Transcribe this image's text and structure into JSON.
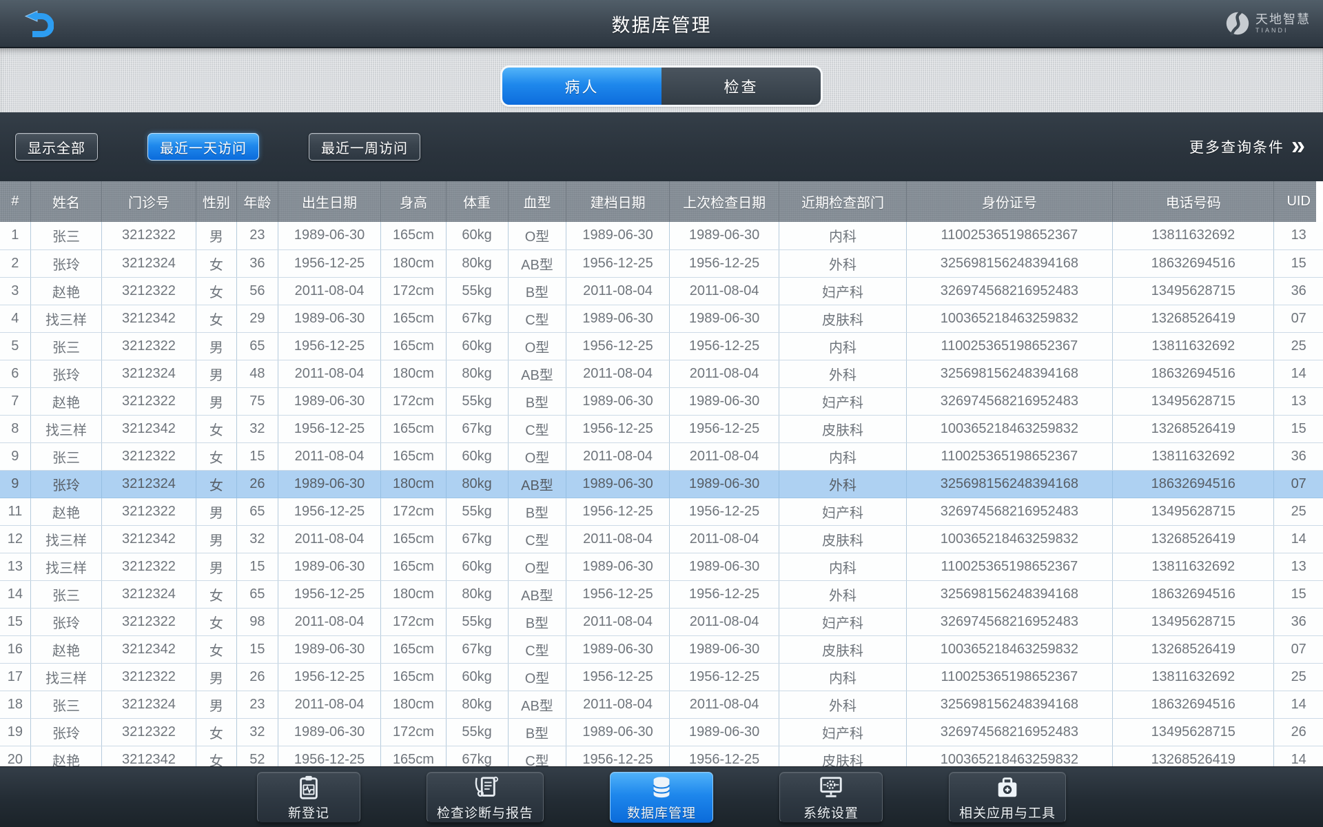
{
  "header": {
    "title": "数据库管理",
    "logo_text": "天地智慧",
    "logo_subtext": "TIANDI"
  },
  "tabs": [
    {
      "label": "病人",
      "active": true
    },
    {
      "label": "检查",
      "active": false
    }
  ],
  "filter_bar": {
    "show_all": "显示全部",
    "last_day": "最近一天访问",
    "last_week": "最近一周访问",
    "more_filters": "更多查询条件",
    "chevron": "»",
    "active_filter": "最近一天访问"
  },
  "table": {
    "columns": [
      "#",
      "姓名",
      "门诊号",
      "性别",
      "年龄",
      "出生日期",
      "身高",
      "体重",
      "血型",
      "建档日期",
      "上次检查日期",
      "近期检查部门",
      "身份证号",
      "电话号码",
      "UID"
    ],
    "highlighted_row_index": 9,
    "rows": [
      [
        "1",
        "张三",
        "3212322",
        "男",
        "23",
        "1989-06-30",
        "165cm",
        "60kg",
        "O型",
        "1989-06-30",
        "1989-06-30",
        "内科",
        "110025365198652367",
        "13811632692",
        "13"
      ],
      [
        "2",
        "张玲",
        "3212324",
        "女",
        "36",
        "1956-12-25",
        "180cm",
        "80kg",
        "AB型",
        "1956-12-25",
        "1956-12-25",
        "外科",
        "325698156248394168",
        "18632694516",
        "15"
      ],
      [
        "3",
        "赵艳",
        "3212322",
        "女",
        "56",
        "2011-08-04",
        "172cm",
        "55kg",
        "B型",
        "2011-08-04",
        "2011-08-04",
        "妇产科",
        "326974568216952483",
        "13495628715",
        "36"
      ],
      [
        "4",
        "找三样",
        "3212342",
        "女",
        "29",
        "1989-06-30",
        "165cm",
        "67kg",
        "C型",
        "1989-06-30",
        "1989-06-30",
        "皮肤科",
        "100365218463259832",
        "13268526419",
        "07"
      ],
      [
        "5",
        "张三",
        "3212322",
        "男",
        "65",
        "1956-12-25",
        "165cm",
        "60kg",
        "O型",
        "1956-12-25",
        "1956-12-25",
        "内科",
        "110025365198652367",
        "13811632692",
        "25"
      ],
      [
        "6",
        "张玲",
        "3212324",
        "男",
        "48",
        "2011-08-04",
        "180cm",
        "80kg",
        "AB型",
        "2011-08-04",
        "2011-08-04",
        "外科",
        "325698156248394168",
        "18632694516",
        "14"
      ],
      [
        "7",
        "赵艳",
        "3212322",
        "男",
        "75",
        "1989-06-30",
        "172cm",
        "55kg",
        "B型",
        "1989-06-30",
        "1989-06-30",
        "妇产科",
        "326974568216952483",
        "13495628715",
        "13"
      ],
      [
        "8",
        "找三样",
        "3212342",
        "女",
        "32",
        "1956-12-25",
        "165cm",
        "67kg",
        "C型",
        "1956-12-25",
        "1956-12-25",
        "皮肤科",
        "100365218463259832",
        "13268526419",
        "15"
      ],
      [
        "9",
        "张三",
        "3212322",
        "女",
        "15",
        "2011-08-04",
        "165cm",
        "60kg",
        "O型",
        "2011-08-04",
        "2011-08-04",
        "内科",
        "110025365198652367",
        "13811632692",
        "36"
      ],
      [
        "9",
        "张玲",
        "3212324",
        "女",
        "26",
        "1989-06-30",
        "180cm",
        "80kg",
        "AB型",
        "1989-06-30",
        "1989-06-30",
        "外科",
        "325698156248394168",
        "18632694516",
        "07"
      ],
      [
        "11",
        "赵艳",
        "3212322",
        "男",
        "65",
        "1956-12-25",
        "172cm",
        "55kg",
        "B型",
        "1956-12-25",
        "1956-12-25",
        "妇产科",
        "326974568216952483",
        "13495628715",
        "25"
      ],
      [
        "12",
        "找三样",
        "3212342",
        "男",
        "32",
        "2011-08-04",
        "165cm",
        "67kg",
        "C型",
        "2011-08-04",
        "2011-08-04",
        "皮肤科",
        "100365218463259832",
        "13268526419",
        "14"
      ],
      [
        "13",
        "找三样",
        "3212322",
        "男",
        "15",
        "1989-06-30",
        "165cm",
        "60kg",
        "O型",
        "1989-06-30",
        "1989-06-30",
        "内科",
        "110025365198652367",
        "13811632692",
        "13"
      ],
      [
        "14",
        "张三",
        "3212324",
        "女",
        "65",
        "1956-12-25",
        "180cm",
        "80kg",
        "AB型",
        "1956-12-25",
        "1956-12-25",
        "外科",
        "325698156248394168",
        "18632694516",
        "15"
      ],
      [
        "15",
        "张玲",
        "3212322",
        "女",
        "98",
        "2011-08-04",
        "172cm",
        "55kg",
        "B型",
        "2011-08-04",
        "2011-08-04",
        "妇产科",
        "326974568216952483",
        "13495628715",
        "36"
      ],
      [
        "16",
        "赵艳",
        "3212342",
        "女",
        "15",
        "1989-06-30",
        "165cm",
        "67kg",
        "C型",
        "1989-06-30",
        "1989-06-30",
        "皮肤科",
        "100365218463259832",
        "13268526419",
        "07"
      ],
      [
        "17",
        "找三样",
        "3212322",
        "男",
        "26",
        "1956-12-25",
        "165cm",
        "60kg",
        "O型",
        "1956-12-25",
        "1956-12-25",
        "内科",
        "110025365198652367",
        "13811632692",
        "25"
      ],
      [
        "18",
        "张三",
        "3212324",
        "男",
        "23",
        "2011-08-04",
        "180cm",
        "80kg",
        "AB型",
        "2011-08-04",
        "2011-08-04",
        "外科",
        "325698156248394168",
        "18632694516",
        "14"
      ],
      [
        "19",
        "张玲",
        "3212322",
        "女",
        "32",
        "1989-06-30",
        "172cm",
        "55kg",
        "B型",
        "1989-06-30",
        "1989-06-30",
        "妇产科",
        "326974568216952483",
        "13495628715",
        "26"
      ],
      [
        "20",
        "赵艳",
        "3212342",
        "女",
        "52",
        "1956-12-25",
        "165cm",
        "67kg",
        "C型",
        "1956-12-25",
        "1956-12-25",
        "皮肤科",
        "100365218463259832",
        "13268526419",
        "14"
      ]
    ]
  },
  "bottom_nav": {
    "items": [
      {
        "label": "新登记",
        "icon": "clipboard-pulse-icon",
        "active": false
      },
      {
        "label": "检查诊断与报告",
        "icon": "report-stethoscope-icon",
        "active": false
      },
      {
        "label": "数据库管理",
        "icon": "database-icon",
        "active": true
      },
      {
        "label": "系统设置",
        "icon": "monitor-gear-icon",
        "active": false
      },
      {
        "label": "相关应用与工具",
        "icon": "medical-kit-icon",
        "active": false
      }
    ]
  },
  "colors": {
    "accent_blue": "#0d6cdc",
    "accent_blue_light": "#53b4f9",
    "topbar_dark": "#2c3640",
    "table_header_gray": "#858e97",
    "highlight_row": "#aed1f2",
    "row_text": "#6f757c"
  }
}
